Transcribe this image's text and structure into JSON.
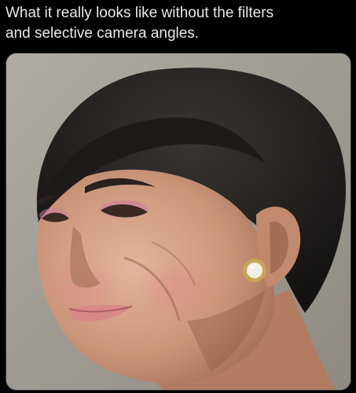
{
  "tweet": {
    "text": "What it really looks like without the filters\nand selective camera angles."
  },
  "media": {
    "kind": "photo",
    "subject": "portrait-close-up"
  },
  "colors": {
    "background": "#000000",
    "text": "#e7e9ea",
    "card_border": "#2f3336"
  }
}
